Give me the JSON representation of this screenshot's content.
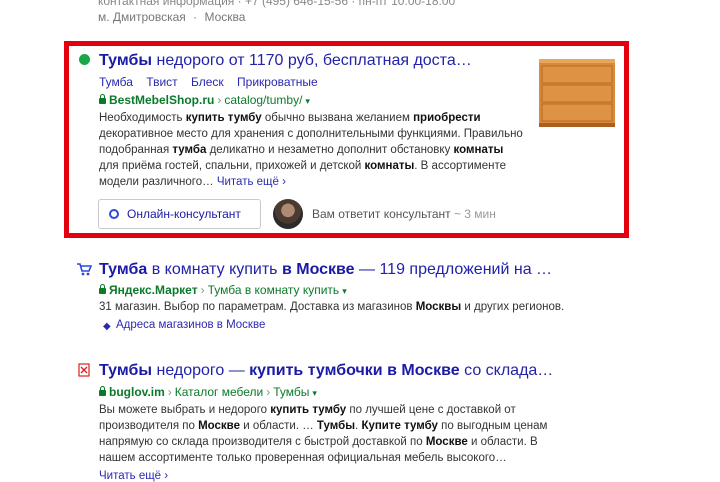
{
  "top_cut": {
    "line1": "контактная информация · +7 (495) 646-15-56 · пн-пт 10:00-18:00",
    "line2_a": "м. Дмитровская",
    "line2_sep": "·",
    "line2_b": "Москва"
  },
  "result1": {
    "title_bold": "Тумбы",
    "title_rest": " недорого от 1170 руб, бесплатная доста…",
    "sitelinks": [
      "Тумба",
      "Твист",
      "Блеск",
      "Прикроватные"
    ],
    "domain": "BestMebelShop.ru",
    "path": "catalog/tumby/",
    "snippet_html_parts": {
      "p1": "Необходимость ",
      "b1": "купить тумбу",
      "p2": " обычно вызвана желанием ",
      "b2": "приобрести",
      "p3": " декоративное место для хранения с дополнительными функциями. Правильно подобранная ",
      "b3": "тумба",
      "p4": " деликатно и незаметно дополнит обстановку ",
      "b4": "комнаты",
      "p5": " для приёма гостей, спальни, прихожей и детской ",
      "b5": "комнаты",
      "p6": ". В ассортименте модели различного… "
    },
    "read_more": "Читать ещё ›",
    "consult_button": "Онлайн-консультант",
    "answer_text": "Вам ответит консультант",
    "answer_time": "~ 3 мин"
  },
  "result2": {
    "title_b1": "Тумба",
    "title_p1": " в комнату купить ",
    "title_b2": "в Москве",
    "title_p2": " — 119 предложений на …",
    "domain": "Яндекс.Маркет",
    "path": "Тумба в комнату купить",
    "snippet_p1": "31 магазин. Выбор по параметрам. Доставка из магазинов ",
    "snippet_b1": "Москвы",
    "snippet_p2": " и других регионов.",
    "addresses_link": "Адреса магазинов в Москве"
  },
  "result3": {
    "title_b1": "Тумбы",
    "title_p1": " недорого — ",
    "title_b2": "купить тумбочки в Москве",
    "title_p2": " со склада…",
    "domain": "buglov.im",
    "path1": "Каталог мебели",
    "path2": "Тумбы",
    "snippet_p1": "Вы можете выбрать и недорого ",
    "snippet_b1": "купить тумбу",
    "snippet_p2": " по лучшей цене с доставкой от производителя по ",
    "snippet_b2": "Москве",
    "snippet_p3": " и области. … ",
    "snippet_b3": "Тумбы",
    "snippet_p4": ". ",
    "snippet_b4": "Купите тумбу",
    "snippet_p5": " по выгодным ценам напрямую со склада производителя с быстрой доставкой по ",
    "snippet_b5": "Москве",
    "snippet_p6": " и области. В нашем ассортименте только проверенная официальная мебель высокого…",
    "read_more": "Читать ещё ›"
  },
  "colors": {
    "highlight_border": "#e3000f",
    "link": "#1a1aa6",
    "path_green": "#0a7a2a"
  }
}
